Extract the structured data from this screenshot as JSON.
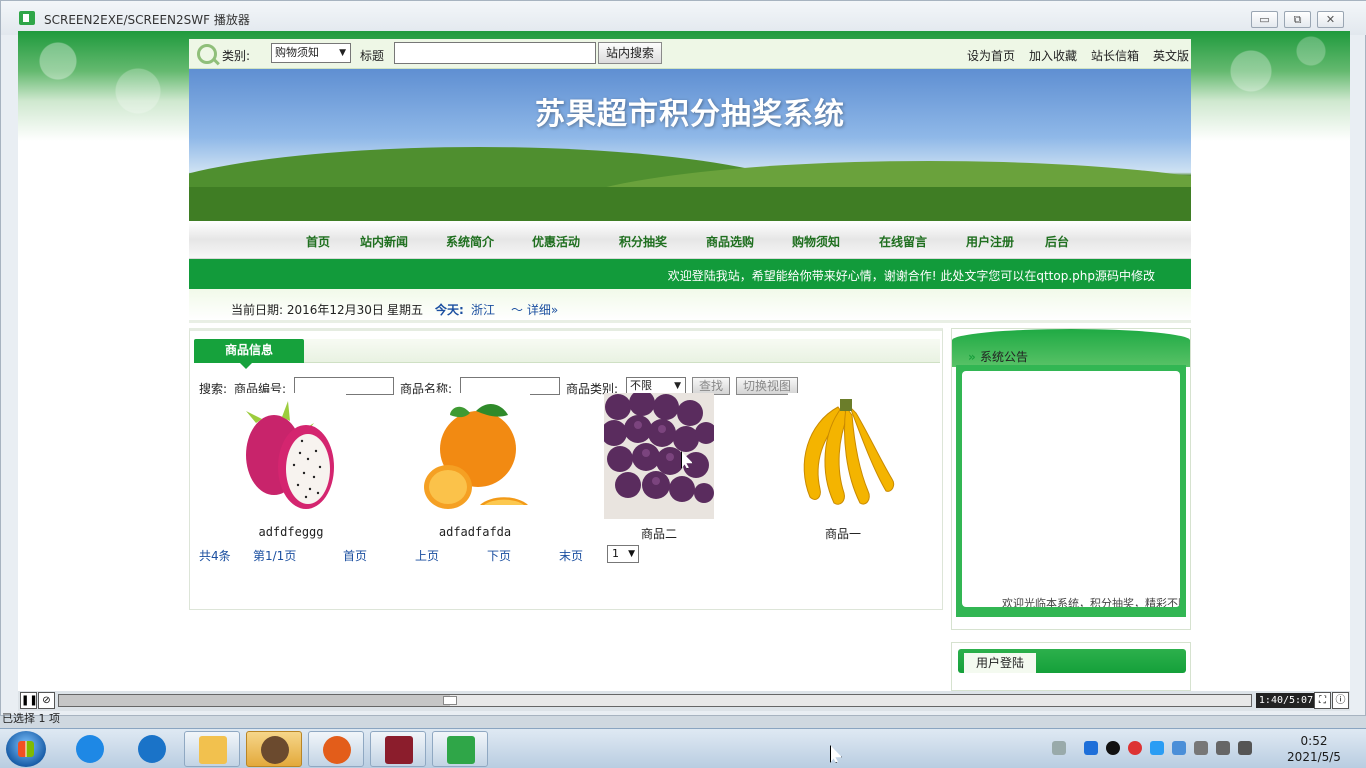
{
  "player": {
    "title": "SCREEN2EXE/SCREEN2SWF 播放器",
    "minimize": "▭",
    "restore": "⧉",
    "close": "✕",
    "time": "1:40/5:07",
    "progress_fraction": 0.328
  },
  "site": {
    "topbar": {
      "category_label": "类别:",
      "category_value": "购物须知",
      "title_label": "标题",
      "search_value": "",
      "search_button": "站内搜索",
      "links": [
        "设为首页",
        "加入收藏",
        "站长信箱",
        "英文版"
      ]
    },
    "banner_title": "苏果超市积分抽奖系统",
    "nav": [
      "首页",
      "站内新闻",
      "系统简介",
      "优惠活动",
      "积分抽奖",
      "商品选购",
      "购物须知",
      "在线留言",
      "用户注册",
      "后台"
    ],
    "marquee": "欢迎登陆我站，希望能给你带来好心情，谢谢合作! 此处文字您可以在qttop.php源码中修改",
    "date_bar": {
      "date": "当前日期: 2016年12月30日",
      "weekday": "星期五",
      "today_label": "今天:",
      "city": "浙江",
      "detail": "～ 详细»"
    },
    "products_panel": {
      "tab": "商品信息",
      "search_label": "搜索:",
      "code_label": "商品编号:",
      "name_label": "商品名称:",
      "type_label": "商品类别:",
      "type_value": "不限",
      "find_button": "查找",
      "switch_button": "切换视图",
      "items": [
        {
          "name": "adfdfeggg",
          "icon": "dragonfruit-image"
        },
        {
          "name": "adfadfafda",
          "icon": "orange-image"
        },
        {
          "name": "商品二",
          "icon": "grape-image"
        },
        {
          "name": "商品一",
          "icon": "banana-image"
        }
      ],
      "pager": {
        "total": "共4条",
        "page": "第1/1页",
        "first": "首页",
        "prev": "上页",
        "next": "下页",
        "last": "末页",
        "select": "1"
      }
    },
    "notice": {
      "title": "系统公告",
      "scroll_text": "欢迎光临本系统，积分抽奖，精彩不断"
    },
    "login": {
      "title": "用户登陆"
    }
  },
  "status_text": "已选择 1 项",
  "taskbar": {
    "time": "0:52",
    "date": "2021/5/5"
  },
  "colors": {
    "site_green": "#129b3b",
    "nav_text": "#1f6f1f",
    "link_blue": "#1b4fa0"
  }
}
